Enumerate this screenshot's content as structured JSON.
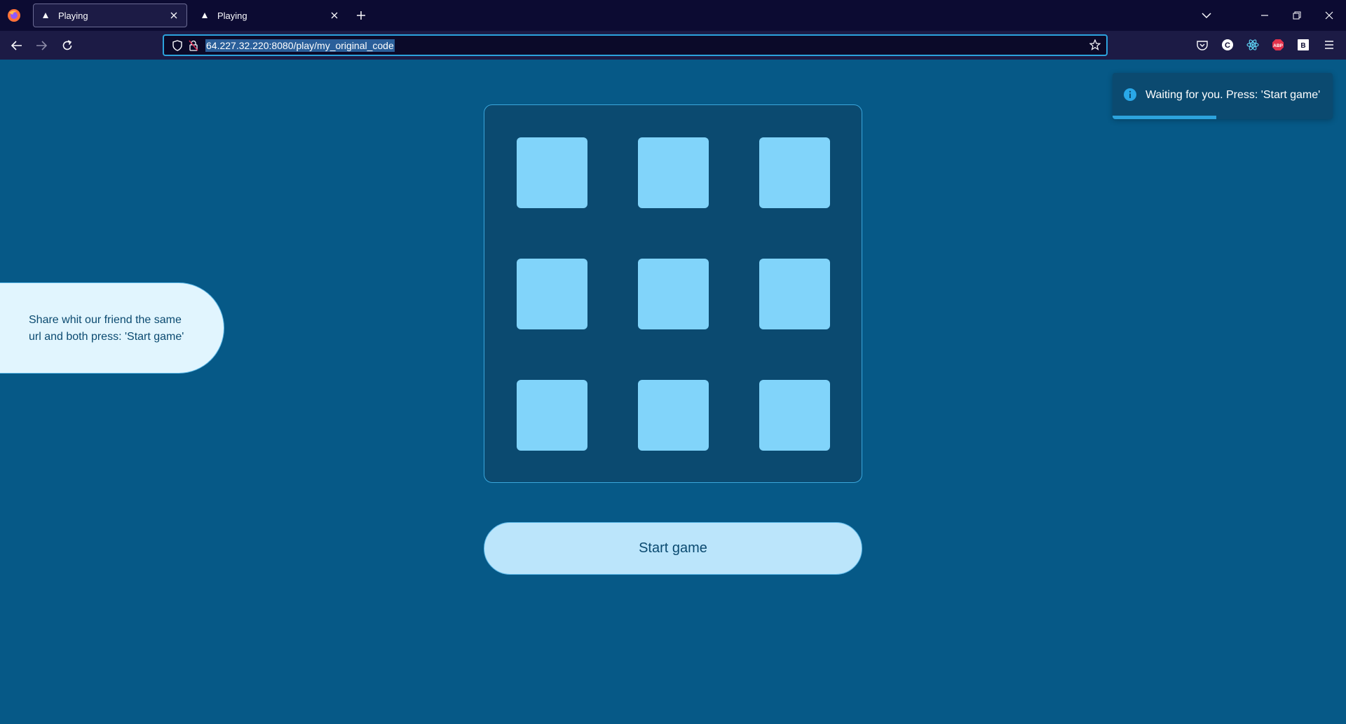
{
  "browser": {
    "tabs": [
      {
        "title": "Playing",
        "active": true
      },
      {
        "title": "Playing",
        "active": false
      }
    ],
    "url": "64.227.32.220:8080/play/my_original_code",
    "extension_labels": {
      "abp": "ABP",
      "b": "B",
      "c": "C"
    }
  },
  "game": {
    "board_cells": [
      "",
      "",
      "",
      "",
      "",
      "",
      "",
      "",
      ""
    ],
    "start_button_label": "Start game",
    "share_message": "Share whit our friend the same url and both press: 'Start game'"
  },
  "toast": {
    "message": "Waiting for you. Press: 'Start game'",
    "progress": 0.47
  },
  "colors": {
    "page_bg": "#065987",
    "board_bg": "#0b4a70",
    "cell": "#81d4fa",
    "button_bg": "#bbe5fb",
    "panel_bg": "#e1f5fe",
    "accent": "#2ca3dd"
  }
}
